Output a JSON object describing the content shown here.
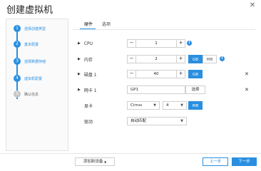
{
  "window": {
    "title": "创建虚拟机"
  },
  "steps": [
    {
      "num": "1",
      "label": "选择创建类型",
      "active": true
    },
    {
      "num": "2",
      "label": "基本配置",
      "active": true
    },
    {
      "num": "3",
      "label": "选择数据存储",
      "active": true
    },
    {
      "num": "4",
      "label": "虚拟机配置",
      "active": true
    },
    {
      "num": "5",
      "label": "确认信息",
      "active": false
    }
  ],
  "tabs": [
    {
      "label": "硬件",
      "active": true
    },
    {
      "label": "选项",
      "active": false
    }
  ],
  "hardware": {
    "cpu": {
      "label": "CPU",
      "value": "1"
    },
    "memory": {
      "label": "内存",
      "value": "2",
      "unit_selected": "GB",
      "unit_other": "MB"
    },
    "disk": {
      "label": "磁盘 1",
      "value": "40",
      "unit_selected": "GB"
    },
    "nic": {
      "label": "网卡 1",
      "value": "GP1",
      "select_button": "选择"
    },
    "display": {
      "label": "显卡",
      "model": "Cirrus",
      "count": "4",
      "unit": "MB"
    },
    "driver": {
      "label": "驱动",
      "value": "自动匹配"
    }
  },
  "footer": {
    "add_device": "添加新设备",
    "prev": "上一步",
    "next": "下一步"
  },
  "colors": {
    "accent": "#2a8fe0"
  }
}
